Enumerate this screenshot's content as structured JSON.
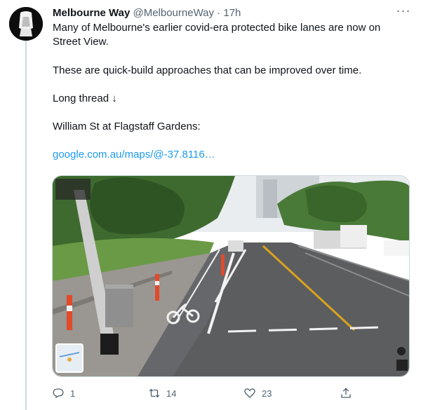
{
  "tweet": {
    "author_name": "Melbourne Way",
    "author_handle": "@MelbourneWay",
    "separator": "·",
    "time": "17h",
    "more_label": "···",
    "paragraphs": [
      "Many of Melbourne's earlier covid-era protected bike lanes are now on Street View.",
      "These are quick-build approaches that can be improved over time.",
      "Long thread ↓",
      "William St at Flagstaff Gardens:"
    ],
    "link": "google.com.au/maps/@-37.8116…"
  },
  "actions": {
    "reply_count": "1",
    "retweet_count": "14",
    "like_count": "23"
  },
  "icons": [
    "avatar-icon",
    "more-icon",
    "reply-icon",
    "retweet-icon",
    "like-icon",
    "share-icon"
  ],
  "colors": {
    "link": "#1d9bf0",
    "muted": "#536471",
    "thread_line": "#cfd9de"
  }
}
